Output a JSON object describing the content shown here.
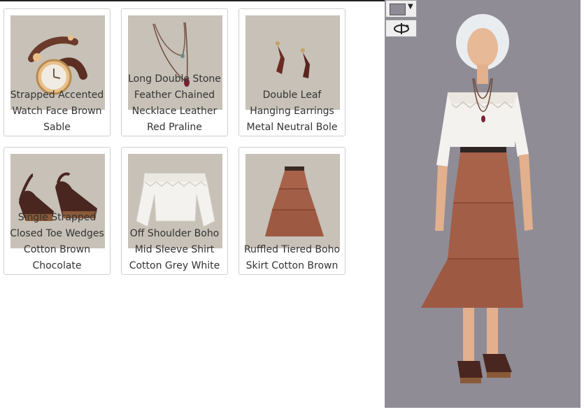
{
  "items": [
    {
      "lines": [
        "Strapped Accented",
        "Watch Face Brown",
        "Sable"
      ]
    },
    {
      "lines": [
        "Long Double Stone",
        "Feather Chained",
        "Necklace Leather",
        "Red Praline"
      ]
    },
    {
      "lines": [
        "Double Leaf",
        "Hanging Earrings",
        "Metal Neutral Bole"
      ]
    },
    {
      "lines": [
        "Single Strapped",
        "Closed Toe Wedges",
        "Cotton Brown",
        "Chocolate"
      ]
    },
    {
      "lines": [
        "Off Shoulder Boho",
        "Mid Sleeve Shirt",
        "Cotton Grey White"
      ]
    },
    {
      "lines": [
        "Ruffled Tiered Boho",
        "Skirt Cotton Brown"
      ]
    }
  ],
  "colors": {
    "thumb_bg": "#c7c1b8",
    "panel_bg": "#8f8c96",
    "skirt": "#a8624a",
    "blouse": "#f4f2ef",
    "shoe": "#4a2620"
  },
  "icons": {
    "color_control": "color-swatch-icon",
    "color_caret": "caret-down-icon",
    "rotate_control": "rotate-icon"
  },
  "controls": {
    "caret_glyph": "▼"
  }
}
